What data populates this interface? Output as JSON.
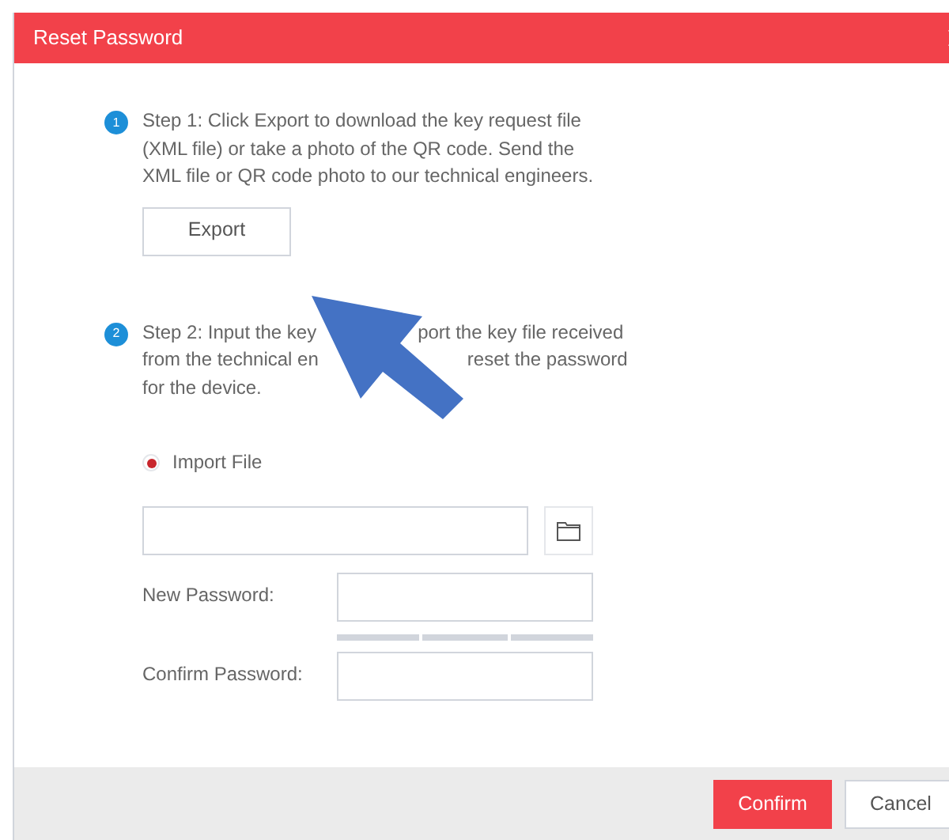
{
  "dialog": {
    "title": "Reset Password",
    "steps": [
      {
        "number": "1",
        "text": "Step 1: Click Export to download the key request file (XML file) or take a photo of the QR code. Send the XML file or QR code photo to our technical engineers.",
        "button": "Export"
      },
      {
        "number": "2",
        "lines": [
          [
            "Step 2: Input the key",
            "port the key file received"
          ],
          [
            "from the technical en",
            "reset the password"
          ],
          [
            "for the device."
          ]
        ]
      }
    ],
    "import_option": {
      "label": "Import File",
      "selected": true
    },
    "fields": [
      {
        "label": "New Password:"
      },
      {
        "label": "Confirm Password:"
      }
    ],
    "buttons": [
      {
        "label": "Confirm",
        "kind": "primary"
      },
      {
        "label": "Cancel",
        "kind": "secondary"
      }
    ]
  }
}
